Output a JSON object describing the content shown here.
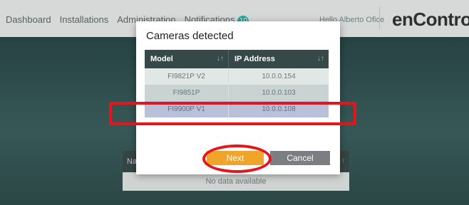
{
  "nav": {
    "items": [
      "Dashboard",
      "Installations",
      "Administration",
      "Notifications"
    ],
    "notification_badge": "10"
  },
  "user": "Hello Alberto Ofice",
  "logo": {
    "text": "enControl",
    "mark": "™"
  },
  "background_table": {
    "header_label": "Na",
    "empty_text": "No data available"
  },
  "modal": {
    "title": "Cameras detected",
    "columns": [
      "Model",
      "IP Address"
    ],
    "rows": [
      {
        "model": "FI9821P V2",
        "ip": "10.0.0.154"
      },
      {
        "model": "FI9851P",
        "ip": "10.0.0.103"
      },
      {
        "model": "FI9900P V1",
        "ip": "10.0.0.108"
      }
    ],
    "next_label": "Next",
    "cancel_label": "Cancel"
  },
  "colors": {
    "accent": "#f0a52a",
    "header_dark": "#374848",
    "selected_row": "#b9c0da",
    "annotation": "#e4151c"
  }
}
